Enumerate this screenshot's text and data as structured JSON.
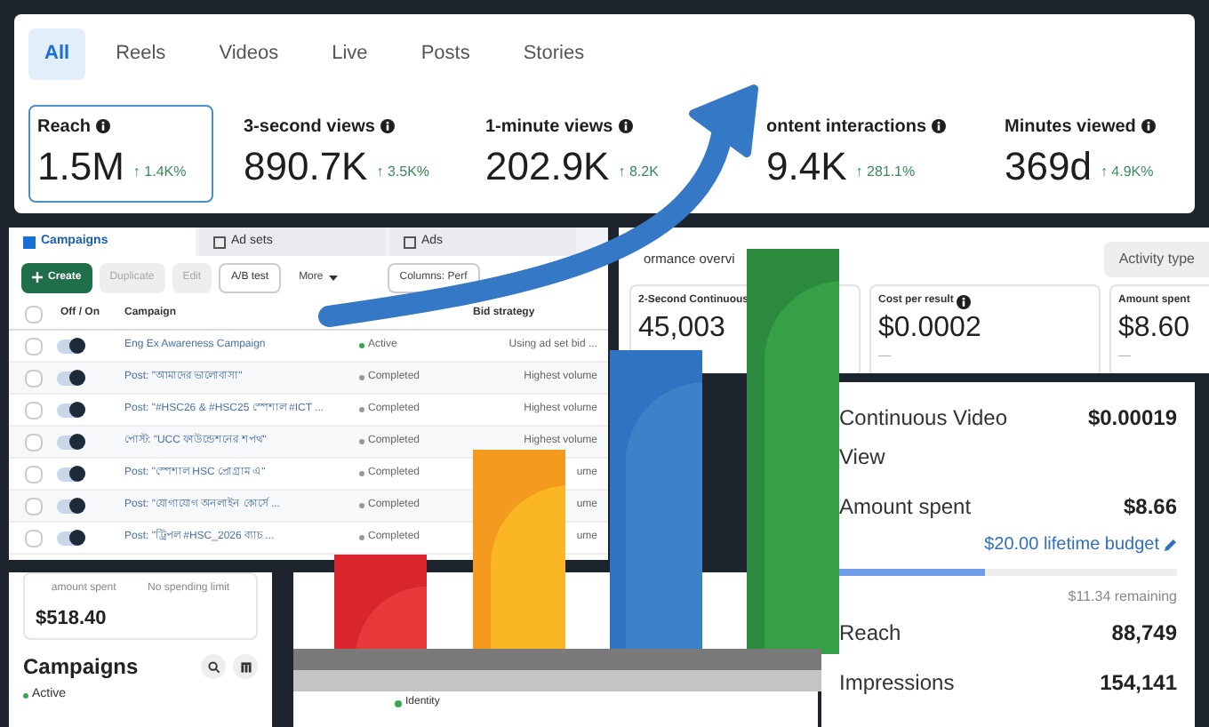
{
  "insights": {
    "tabs": [
      {
        "label": "All",
        "selected": true
      },
      {
        "label": "Reels",
        "selected": false
      },
      {
        "label": "Videos",
        "selected": false
      },
      {
        "label": "Live",
        "selected": false
      },
      {
        "label": "Posts",
        "selected": false
      },
      {
        "label": "Stories",
        "selected": false
      }
    ],
    "metrics": [
      {
        "label": "Reach",
        "value": "1.5M",
        "change": "↑ 1.4K%",
        "selected": true
      },
      {
        "label": "3-second views",
        "value": "890.7K",
        "change": "↑ 3.5K%",
        "selected": false
      },
      {
        "label": "1-minute views",
        "value": "202.9K",
        "change": "↑ 8.2K",
        "selected": false
      },
      {
        "label": "ontent interactions",
        "value": "9.4K",
        "change": "↑ 281.1%",
        "selected": false
      },
      {
        "label": "Minutes viewed",
        "value": "369d",
        "change": "↑ 4.9K%",
        "selected": false
      }
    ]
  },
  "ads_manager": {
    "tabs": [
      {
        "label": "Campaigns",
        "selected": true
      },
      {
        "label": "Ad sets",
        "selected": false
      },
      {
        "label": "Ads",
        "selected": false
      }
    ],
    "toolbar": [
      {
        "label": "Create",
        "kind": "primary",
        "disabled": false
      },
      {
        "label": "Duplicate",
        "kind": "plain",
        "disabled": true
      },
      {
        "label": "Edit",
        "kind": "plain",
        "disabled": true
      },
      {
        "label": "A/B test",
        "kind": "plain",
        "disabled": false
      },
      {
        "label": "More",
        "kind": "menu",
        "disabled": false
      },
      {
        "label": "Columns: Perf",
        "kind": "columns",
        "disabled": false
      }
    ],
    "select_all": false,
    "columns": [
      "Off / On",
      "Campaign",
      "Bid strategy"
    ],
    "rows": [
      {
        "checked": false,
        "on": true,
        "name": "Eng Ex Awareness Campaign",
        "delivery": "Active",
        "active": true,
        "bid": "Using ad set bid ..."
      },
      {
        "checked": false,
        "on": true,
        "name": "Post: \"আমাদের ভালোবাসা\"",
        "delivery": "Completed",
        "active": false,
        "bid": "Highest volume"
      },
      {
        "checked": false,
        "on": true,
        "name": "Post: \"#HSC26 & #HSC25 স্পেশাল #ICT ...",
        "delivery": "Completed",
        "active": false,
        "bid": "Highest volume"
      },
      {
        "checked": false,
        "on": true,
        "name": "পোস্ট: \"UCC ফাউন্ডেশনের শপথ\"",
        "delivery": "Completed",
        "active": false,
        "bid": "Highest volume"
      },
      {
        "checked": false,
        "on": true,
        "name": "Post: \"স্পেশাল HSC প্রোগ্রাম এ\"",
        "delivery": "Completed",
        "active": false,
        "bid": "ume"
      },
      {
        "checked": false,
        "on": true,
        "name": "Post: \"যোগাযোগ অনলাইন কোর্সে ...",
        "delivery": "Completed",
        "active": false,
        "bid": "ume"
      },
      {
        "checked": false,
        "on": true,
        "name": "Post: \"ট্রিপল #HSC_2026 ব্যাচ ...",
        "delivery": "Completed",
        "active": false,
        "bid": "ume"
      }
    ]
  },
  "performance": {
    "title": "ormance overvi",
    "button": "Activity type",
    "cards": [
      {
        "label": "2-Second Continuous",
        "value": "45,003"
      },
      {
        "label": "Cost per result",
        "value": "$0.0002",
        "note": "—",
        "info": true
      },
      {
        "label": "Amount spent",
        "value": "$8.60",
        "note": "—"
      }
    ]
  },
  "details": {
    "rows": [
      {
        "label": "Continuous Video View",
        "value": "$0.00019"
      },
      {
        "label": "Amount spent",
        "value": "$8.66"
      }
    ],
    "budget": {
      "label": "$20.00 lifetime budget",
      "level": 0.43,
      "remaining": "$11.34 remaining"
    },
    "rows2": [
      {
        "label": "Reach",
        "value": "88,749"
      },
      {
        "label": "Impressions",
        "value": "154,141"
      }
    ]
  },
  "account": {
    "spent_label": "amount spent",
    "limit_label": "No spending limit",
    "spent": "$518.40",
    "title": "Campaigns",
    "status": "Active"
  },
  "setup": {
    "identity": "Identity"
  }
}
